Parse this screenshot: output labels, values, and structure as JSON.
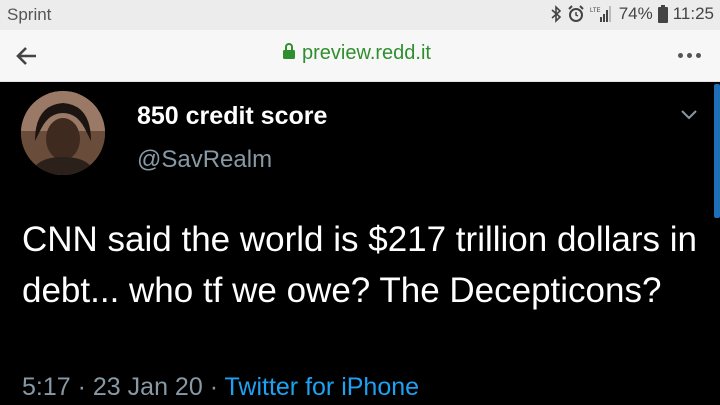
{
  "status_bar": {
    "carrier": "Sprint",
    "battery": "74%",
    "time": "11:25",
    "network_label": "LTE"
  },
  "browser": {
    "url": "preview.redd.it",
    "secure": true,
    "accent_color": "#2f8f2f"
  },
  "tweet": {
    "display_name": "850 credit score",
    "handle": "@SavRealm",
    "text": "CNN said the world is $217 trillion dollars in debt... who tf we owe? The Decepticons?",
    "time": "5:17",
    "separator": "·",
    "date": "23 Jan 20",
    "source": "Twitter for iPhone",
    "link_color": "#1da1f2"
  }
}
